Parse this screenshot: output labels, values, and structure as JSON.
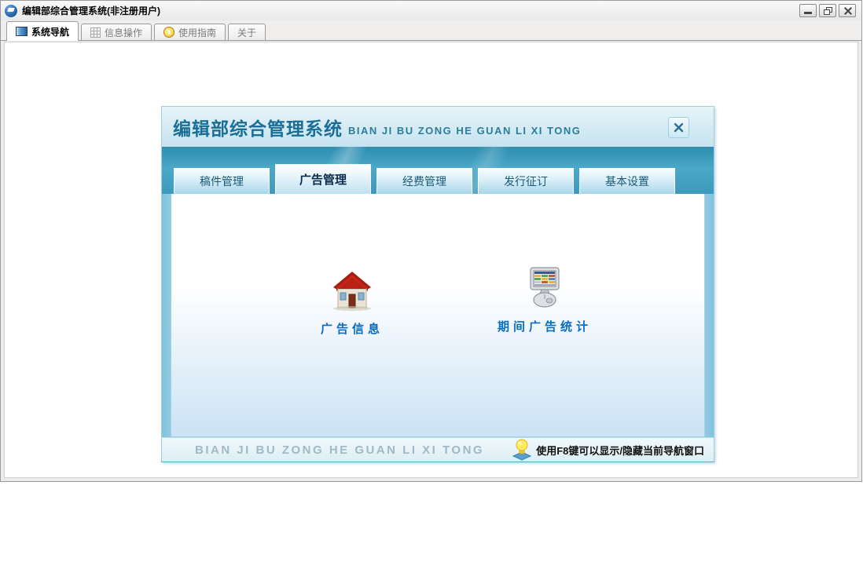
{
  "colors": {
    "band_teal": "#3d9abc",
    "dialog_title_text": "#1b6e96",
    "shortcut_label_text": "#0a6dc0",
    "footer_pinyin_text": "#9fb9c6"
  },
  "window": {
    "title": "编辑部综合管理系统(非注册用户)"
  },
  "main_tabs": [
    {
      "label": "系统导航",
      "icon": "nav-square-icon",
      "active": true
    },
    {
      "label": "信息操作",
      "icon": "grid-icon",
      "active": false
    },
    {
      "label": "使用指南",
      "icon": "guide-icon",
      "active": false
    },
    {
      "label": "关于",
      "active": false
    }
  ],
  "dialog": {
    "title_cn": "编辑部综合管理系统",
    "title_pinyin": "BIAN JI BU ZONG HE GUAN LI XI TONG",
    "tabs": [
      {
        "label": "稿件管理",
        "active": false
      },
      {
        "label": "广告管理",
        "active": true
      },
      {
        "label": "经费管理",
        "active": false
      },
      {
        "label": "发行征订",
        "active": false
      },
      {
        "label": "基本设置",
        "active": false
      }
    ],
    "shortcuts": [
      {
        "label": "广告信息",
        "icon": "house-icon"
      },
      {
        "label": "期间广告统计",
        "icon": "computer-icon"
      }
    ],
    "footer": {
      "pinyin": "BIAN JI BU ZONG HE GUAN LI XI TONG",
      "tip": "使用F8键可以显示/隐藏当前导航窗口"
    }
  }
}
